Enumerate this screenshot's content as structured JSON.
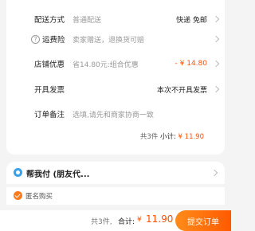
{
  "order_details": {
    "delivery": {
      "label": "配送方式",
      "value": "普通配送",
      "right": "快递 免邮"
    },
    "shipping_insurance": {
      "label": "运费险",
      "value": "卖家赠送，退换货可赔"
    },
    "store_discount": {
      "label": "店铺优惠",
      "value": "省14.80元:组合优惠",
      "right": "- ¥ 14.80"
    },
    "invoice": {
      "label": "开具发票",
      "right": "本次不开具发票"
    },
    "order_note": {
      "label": "订单备注",
      "placeholder": "选填,请先和商家协商一致"
    },
    "subtotal": {
      "count": "共3件",
      "label": "小计:",
      "price": "¥ 11.90"
    }
  },
  "help_pay": {
    "label": "帮我付 (朋友代..."
  },
  "anonymous": {
    "label": "匿名购买"
  },
  "bottom_bar": {
    "count": "共3件,",
    "total_label": "合计:",
    "currency": "¥",
    "price": "11.90",
    "submit_label": "提交订单"
  },
  "colors": {
    "accent": "#ff5000",
    "button_gradient_start": "#ff8c1a",
    "help_icon": "#3aa0e8"
  },
  "icons": {
    "question": "question-circle-icon",
    "chevron": "chevron-right-icon",
    "help": "help-pay-icon",
    "check": "check-circle-icon"
  }
}
